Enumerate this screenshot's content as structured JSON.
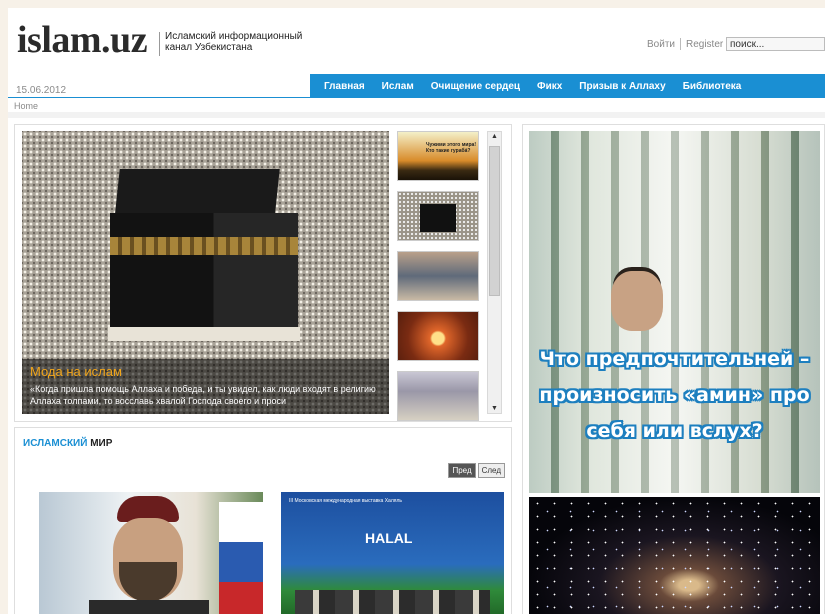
{
  "header": {
    "logo": "islam.uz",
    "tagline": "Исламский информационный канал Узбекистана",
    "login": "Войти",
    "register": "Register",
    "search_placeholder": "поиск..."
  },
  "date": "15.06.2012",
  "breadcrumb": "Home",
  "nav": {
    "items": [
      "Главная",
      "Ислам",
      "Очищение сердец",
      "Фикх",
      "Призыв к Аллаху",
      "Библиотека"
    ]
  },
  "slider": {
    "caption_title": "Мода на ислам",
    "caption_text": "«Когда пришла помощь Аллаха и победа, и ты увидел, как люди входят в религию Аллаха толпами, то восславь хвалой Господа своего и проси",
    "thumb1_text": "Чужими этого мира! Кто такие гурабá?"
  },
  "world": {
    "title_blue": "ИСЛАМСКИЙ",
    "title_dark": "МИР",
    "prev_label": "Пред",
    "next_label": "След",
    "halal_text": "HALAL",
    "expo_text": "III Московская международная выставка Халяль"
  },
  "banner": {
    "text": "Что предпочтительней – произносить «амин» про себя или вслух?"
  },
  "colors": {
    "accent": "#1a8fd3",
    "caption_title": "#f1a51a"
  }
}
